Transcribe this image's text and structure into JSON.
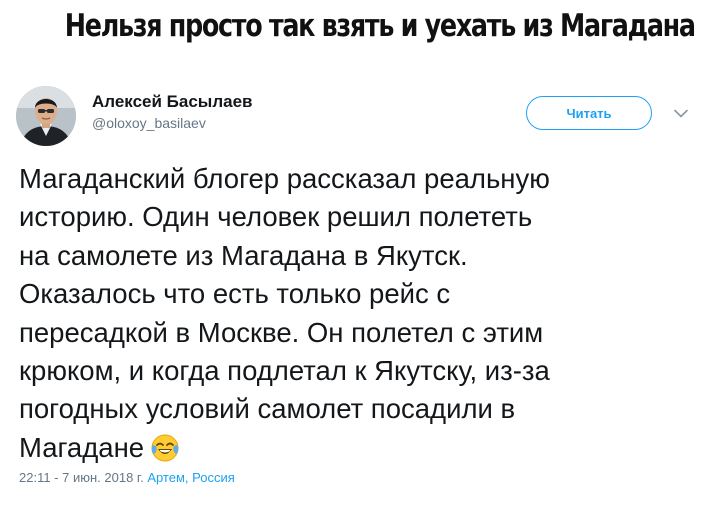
{
  "meme": {
    "title": "Нельзя просто так взять и уехать из Магадана"
  },
  "tweet": {
    "author": {
      "name": "Алексей Басылаев",
      "handle": "@oloxoy_basilaev",
      "avatar_icon": "user-avatar-photo"
    },
    "follow_label": "Читать",
    "more_icon": "chevron-down-icon",
    "text_lines": [
      "Магаданский блогер рассказал реальную",
      "историю. Один человек решил полететь",
      "на самолете из Магадана в Якутск.",
      "Оказалось что есть только рейс с",
      "пересадкой в Москве. Он полетел с этим",
      "крюком, и когда подлетал к Якутску, из-за",
      "погодных условий самолет посадили в",
      "Магадане"
    ],
    "emoji_icon": "face-with-tears-of-joy-icon",
    "timestamp": "22:11 - 7 июн. 2018 г.",
    "location": "Артем, Россия"
  },
  "colors": {
    "link_blue": "#1da1f2",
    "secondary_gray": "#657786",
    "text_dark": "#14171a"
  }
}
